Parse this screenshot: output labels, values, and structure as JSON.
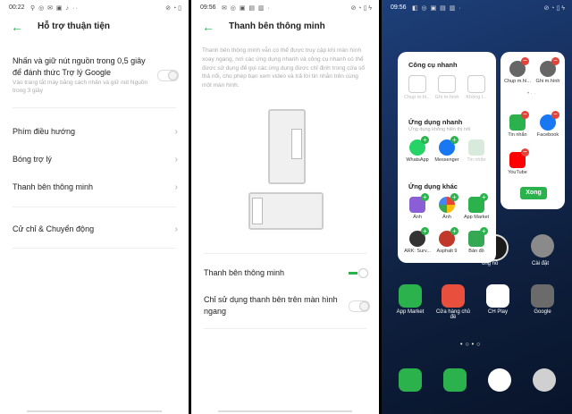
{
  "screen1": {
    "status_time": "00:22",
    "status_icons": "⚲ ◎ ✉ ▣ ♪ ··",
    "status_right": "⊘ ◔ ▯",
    "title": "Hỗ trợ thuận tiện",
    "items": [
      {
        "label": "Nhấn và giữ nút nguồn trong 0,5 giây để đánh thức Trợ lý Google",
        "sub": "Vào trang tắt máy bằng cách nhấn và giữ nút Nguồn trong 3 giây"
      },
      {
        "label": "Phím điều hướng"
      },
      {
        "label": "Bóng trợ lý"
      },
      {
        "label": "Thanh bên thông minh"
      },
      {
        "label": "Cử chỉ & Chuyển động"
      }
    ]
  },
  "screen2": {
    "status_time": "09:56",
    "status_icons": "✉ ◎ ▣ ▤ ▥ ·",
    "status_right": "⊘ ◔ ▯ ϟ",
    "title": "Thanh bên thông minh",
    "description": "Thanh bên thông minh vẫn có thể được truy cập khi màn hình xoay ngang, nơi các ứng dụng nhanh và công cụ nhanh có thể được sử dụng để gọi các ứng dụng được chỉ định trong cửa sổ thả nổi, cho phép bạn xem video và trả lời tin nhắn trên cùng một màn hình.",
    "toggles": [
      {
        "label": "Thanh bên thông minh",
        "on": true
      },
      {
        "label": "Chỉ sử dụng thanh bên trên màn hình ngang",
        "on": false
      }
    ]
  },
  "screen3": {
    "status_time": "09:56",
    "status_icons": "◧ ◎ ▣ ▤ ▥ ·",
    "status_right": "⊘ ◔ ▯ ϟ",
    "quick_tools_title": "Công cụ nhanh",
    "quick_tools": [
      {
        "label": "Chụp m.hì...",
        "icon": "screenshot-icon"
      },
      {
        "label": "Ghi m.hình",
        "icon": "screen-record-icon"
      },
      {
        "label": "Không l...",
        "icon": "do-not-disturb-icon"
      }
    ],
    "quick_apps_title": "Ứng dụng nhanh",
    "quick_apps_sub": "Ứng dụng không hiển thị nổi",
    "quick_apps": [
      {
        "label": "WhatsApp",
        "color": "#25d366"
      },
      {
        "label": "Messenger",
        "color": "#1877f2"
      },
      {
        "label": "Tin nhắn",
        "color": "#d7eadb"
      }
    ],
    "other_apps_title": "Ứng dụng khác",
    "other_apps": [
      {
        "label": "Ảnh",
        "color": "#8a5fd6"
      },
      {
        "label": "Ảnh",
        "color": "#f4b400"
      },
      {
        "label": "App Market",
        "color": "#2bb24c"
      },
      {
        "label": "ARK: Surv...",
        "color": "#333333"
      },
      {
        "label": "Asphalt 9",
        "color": "#c0392b"
      },
      {
        "label": "Bản đồ",
        "color": "#34a853"
      }
    ],
    "side_panel": {
      "tools": [
        {
          "label": "Chụp m.hì...",
          "icon": "screenshot-icon"
        },
        {
          "label": "Ghi m.hình",
          "icon": "screen-record-icon"
        }
      ],
      "apps": [
        {
          "label": "Tin nhắn",
          "color": "#2bb24c"
        },
        {
          "label": "Facebook",
          "color": "#1877f2"
        },
        {
          "label": "YouTube",
          "color": "#ff0000"
        }
      ],
      "done_button": "Xong"
    },
    "home_apps": [
      {
        "label": "App Market",
        "color": "#2bb24c"
      },
      {
        "label": "Cửa hàng chủ đề",
        "color": "#e84f3d"
      },
      {
        "label": "CH Play",
        "color": "#ffffff"
      },
      {
        "label": "Google",
        "color": "#6b6b6b"
      }
    ],
    "partial_labels": [
      "ồng hồ",
      "Cài đặt"
    ],
    "dock_colors": [
      "#2bb24c",
      "#2bb24c",
      "#ffffff",
      "#d0d0d0"
    ]
  }
}
